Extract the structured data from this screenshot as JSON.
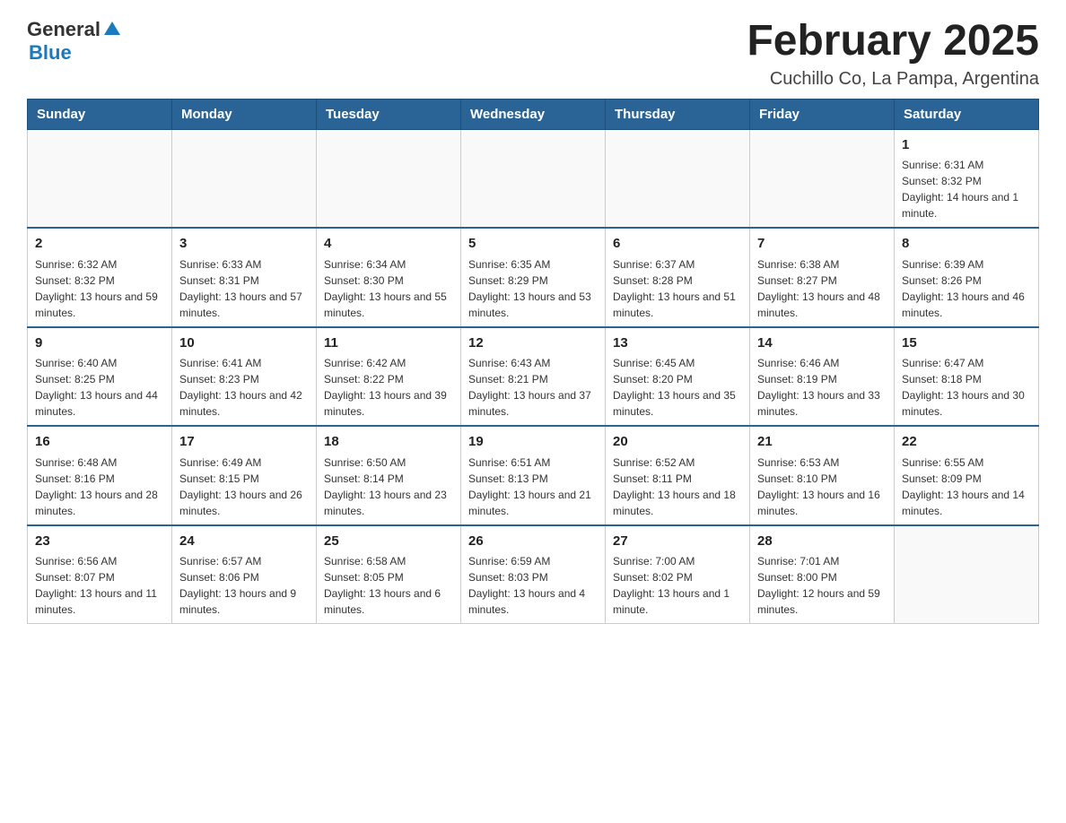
{
  "header": {
    "logo_general": "General",
    "logo_blue": "Blue",
    "month_title": "February 2025",
    "location": "Cuchillo Co, La Pampa, Argentina"
  },
  "days_of_week": [
    "Sunday",
    "Monday",
    "Tuesday",
    "Wednesday",
    "Thursday",
    "Friday",
    "Saturday"
  ],
  "weeks": [
    [
      {
        "day": "",
        "info": ""
      },
      {
        "day": "",
        "info": ""
      },
      {
        "day": "",
        "info": ""
      },
      {
        "day": "",
        "info": ""
      },
      {
        "day": "",
        "info": ""
      },
      {
        "day": "",
        "info": ""
      },
      {
        "day": "1",
        "info": "Sunrise: 6:31 AM\nSunset: 8:32 PM\nDaylight: 14 hours and 1 minute."
      }
    ],
    [
      {
        "day": "2",
        "info": "Sunrise: 6:32 AM\nSunset: 8:32 PM\nDaylight: 13 hours and 59 minutes."
      },
      {
        "day": "3",
        "info": "Sunrise: 6:33 AM\nSunset: 8:31 PM\nDaylight: 13 hours and 57 minutes."
      },
      {
        "day": "4",
        "info": "Sunrise: 6:34 AM\nSunset: 8:30 PM\nDaylight: 13 hours and 55 minutes."
      },
      {
        "day": "5",
        "info": "Sunrise: 6:35 AM\nSunset: 8:29 PM\nDaylight: 13 hours and 53 minutes."
      },
      {
        "day": "6",
        "info": "Sunrise: 6:37 AM\nSunset: 8:28 PM\nDaylight: 13 hours and 51 minutes."
      },
      {
        "day": "7",
        "info": "Sunrise: 6:38 AM\nSunset: 8:27 PM\nDaylight: 13 hours and 48 minutes."
      },
      {
        "day": "8",
        "info": "Sunrise: 6:39 AM\nSunset: 8:26 PM\nDaylight: 13 hours and 46 minutes."
      }
    ],
    [
      {
        "day": "9",
        "info": "Sunrise: 6:40 AM\nSunset: 8:25 PM\nDaylight: 13 hours and 44 minutes."
      },
      {
        "day": "10",
        "info": "Sunrise: 6:41 AM\nSunset: 8:23 PM\nDaylight: 13 hours and 42 minutes."
      },
      {
        "day": "11",
        "info": "Sunrise: 6:42 AM\nSunset: 8:22 PM\nDaylight: 13 hours and 39 minutes."
      },
      {
        "day": "12",
        "info": "Sunrise: 6:43 AM\nSunset: 8:21 PM\nDaylight: 13 hours and 37 minutes."
      },
      {
        "day": "13",
        "info": "Sunrise: 6:45 AM\nSunset: 8:20 PM\nDaylight: 13 hours and 35 minutes."
      },
      {
        "day": "14",
        "info": "Sunrise: 6:46 AM\nSunset: 8:19 PM\nDaylight: 13 hours and 33 minutes."
      },
      {
        "day": "15",
        "info": "Sunrise: 6:47 AM\nSunset: 8:18 PM\nDaylight: 13 hours and 30 minutes."
      }
    ],
    [
      {
        "day": "16",
        "info": "Sunrise: 6:48 AM\nSunset: 8:16 PM\nDaylight: 13 hours and 28 minutes."
      },
      {
        "day": "17",
        "info": "Sunrise: 6:49 AM\nSunset: 8:15 PM\nDaylight: 13 hours and 26 minutes."
      },
      {
        "day": "18",
        "info": "Sunrise: 6:50 AM\nSunset: 8:14 PM\nDaylight: 13 hours and 23 minutes."
      },
      {
        "day": "19",
        "info": "Sunrise: 6:51 AM\nSunset: 8:13 PM\nDaylight: 13 hours and 21 minutes."
      },
      {
        "day": "20",
        "info": "Sunrise: 6:52 AM\nSunset: 8:11 PM\nDaylight: 13 hours and 18 minutes."
      },
      {
        "day": "21",
        "info": "Sunrise: 6:53 AM\nSunset: 8:10 PM\nDaylight: 13 hours and 16 minutes."
      },
      {
        "day": "22",
        "info": "Sunrise: 6:55 AM\nSunset: 8:09 PM\nDaylight: 13 hours and 14 minutes."
      }
    ],
    [
      {
        "day": "23",
        "info": "Sunrise: 6:56 AM\nSunset: 8:07 PM\nDaylight: 13 hours and 11 minutes."
      },
      {
        "day": "24",
        "info": "Sunrise: 6:57 AM\nSunset: 8:06 PM\nDaylight: 13 hours and 9 minutes."
      },
      {
        "day": "25",
        "info": "Sunrise: 6:58 AM\nSunset: 8:05 PM\nDaylight: 13 hours and 6 minutes."
      },
      {
        "day": "26",
        "info": "Sunrise: 6:59 AM\nSunset: 8:03 PM\nDaylight: 13 hours and 4 minutes."
      },
      {
        "day": "27",
        "info": "Sunrise: 7:00 AM\nSunset: 8:02 PM\nDaylight: 13 hours and 1 minute."
      },
      {
        "day": "28",
        "info": "Sunrise: 7:01 AM\nSunset: 8:00 PM\nDaylight: 12 hours and 59 minutes."
      },
      {
        "day": "",
        "info": ""
      }
    ]
  ]
}
